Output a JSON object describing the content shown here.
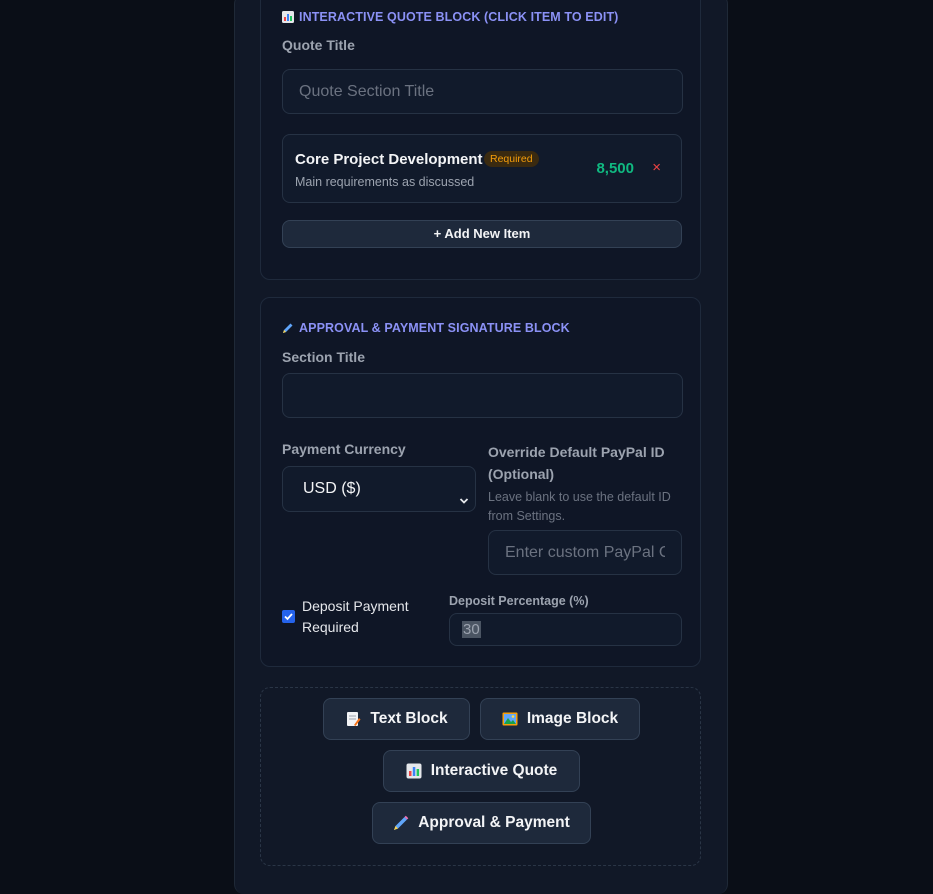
{
  "quote_block": {
    "heading": "INTERACTIVE QUOTE BLOCK (CLICK ITEM TO EDIT)",
    "title_label": "Quote Title",
    "title_placeholder": "Quote Section Title",
    "items": [
      {
        "title": "Core Project Development",
        "badge": "Required",
        "description": "Main requirements as discussed",
        "price": "8,500",
        "remove": "×"
      }
    ],
    "add_item_label": "+ Add New Item"
  },
  "approval_block": {
    "heading": "APPROVAL & PAYMENT SIGNATURE BLOCK",
    "section_title_label": "Section Title",
    "section_title_value": "",
    "currency_label": "Payment Currency",
    "currency_value": "USD ($)",
    "paypal_label": "Override Default PayPal ID (Optional)",
    "paypal_help": "Leave blank to use the default ID from Settings.",
    "paypal_placeholder": "Enter custom PayPal C",
    "deposit_checkbox_label": "Deposit Payment Required",
    "deposit_checked": true,
    "deposit_pct_label": "Deposit Percentage (%)",
    "deposit_pct_value": "30"
  },
  "add_blocks": {
    "text_block": "Text Block",
    "image_block": "Image Block",
    "interactive_quote": "Interactive Quote",
    "approval_payment": "Approval & Payment"
  },
  "colors": {
    "accent": "#8b91f5",
    "price": "#10b981",
    "remove": "#ef4444",
    "badge": "#f59e0b",
    "background": "#0a0e17"
  }
}
